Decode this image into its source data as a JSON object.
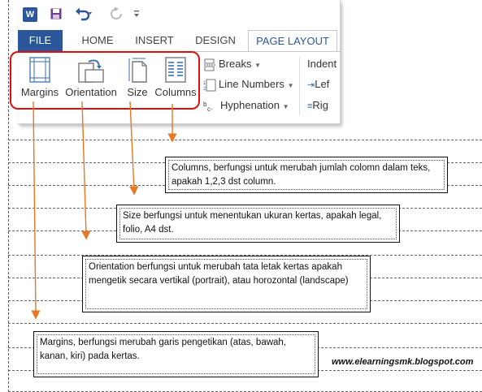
{
  "ribbon": {
    "app_icon_letter": "W",
    "tabs": [
      "FILE",
      "HOME",
      "INSERT",
      "DESIGN",
      "PAGE LAYOUT"
    ],
    "active_tab": "PAGE LAYOUT",
    "big_buttons": [
      "Margins",
      "Orientation",
      "Size",
      "Columns"
    ],
    "small_buttons": [
      "Breaks",
      "Line Numbers",
      "Hyphenation"
    ],
    "indent_label": "Indent",
    "left_label": "Lef",
    "right_label": "Rig"
  },
  "callouts": {
    "columns": "Columns, berfungsi untuk merubah jumlah colomn dalam teks, apakah 1,2,3 dst column.",
    "size": "Size berfungsi untuk menentukan ukuran kertas, apakah legal, folio, A4 dst.",
    "orientation": "Orientation berfungsi untuk merubah tata letak kertas apakah mengetik secara vertikal (portrait), atau horozontal (landscape)",
    "margins": "Margins, berfungsi merubah garis pengetikan (atas, bawah, kanan, kiri) pada kertas."
  },
  "credit": "www.elearningsmk.blogspot.com",
  "colors": {
    "file_tab": "#2b579a",
    "active_tab_text": "#2b579a",
    "highlight": "#e01010",
    "arrow": "#e87722"
  }
}
